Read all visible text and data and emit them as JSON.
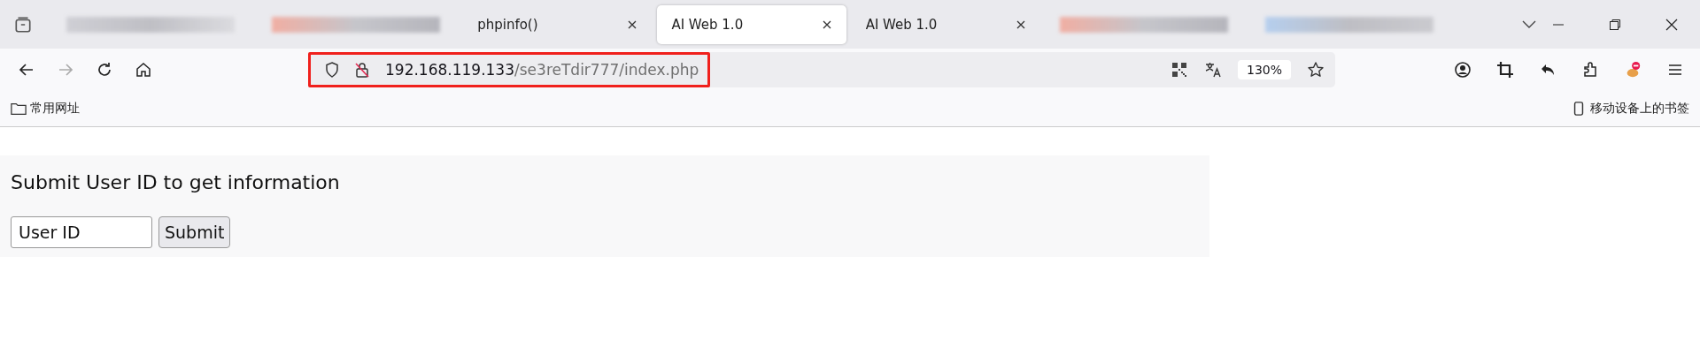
{
  "tabs": [
    {
      "kind": "blurred",
      "selected": false
    },
    {
      "kind": "blurred",
      "selected": false
    },
    {
      "kind": "page",
      "title": "phpinfo()",
      "selected": false
    },
    {
      "kind": "page",
      "title": "AI Web 1.0",
      "selected": true
    },
    {
      "kind": "page",
      "title": "AI Web 1.0",
      "selected": false
    },
    {
      "kind": "blurred",
      "selected": false
    },
    {
      "kind": "blurred",
      "selected": false
    }
  ],
  "address_bar": {
    "host": "192.168.119.133",
    "path": "/se3reTdir777/index.php",
    "highlighted": true,
    "zoom": "130%"
  },
  "bookmarks": {
    "folder": "常用网址",
    "mobile": "移动设备上的书签"
  },
  "page": {
    "heading": "Submit User ID to get information",
    "input_placeholder": "User ID",
    "button": "Submit"
  }
}
